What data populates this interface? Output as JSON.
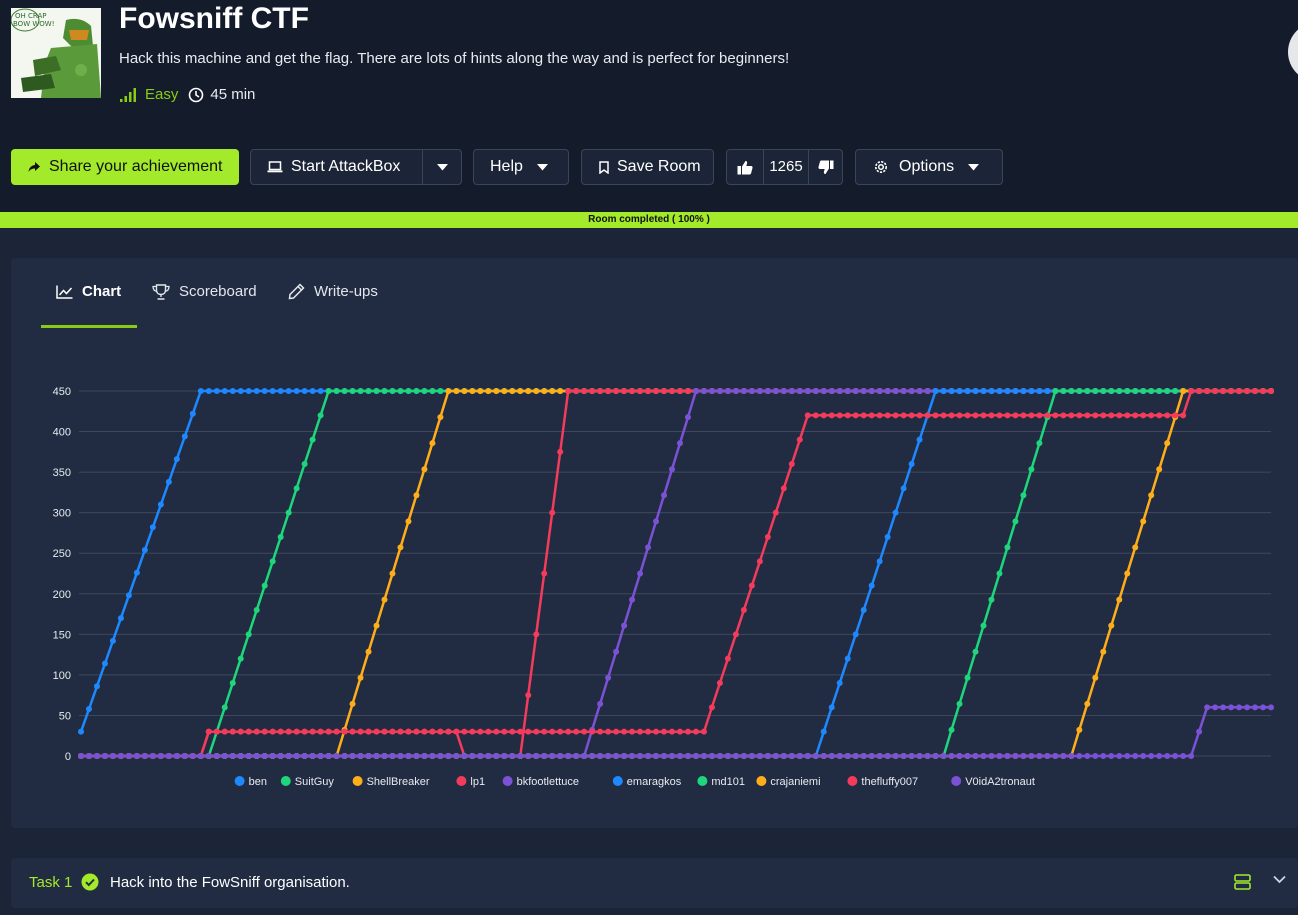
{
  "room": {
    "title": "Fowsniff CTF",
    "description": "Hack this machine and get the flag. There are lots of hints along the way and is perfect for beginners!",
    "difficulty": "Easy",
    "duration": "45 min",
    "avatar_text": [
      "OH CRAP",
      "BOW WOW!"
    ]
  },
  "actions": {
    "share_label": "Share your achievement",
    "attackbox_label": "Start AttackBox",
    "help_label": "Help",
    "save_label": "Save Room",
    "votes": "1265",
    "options_label": "Options"
  },
  "progress": {
    "label": "Room completed ( 100% )",
    "value": 100
  },
  "tabs": {
    "chart": "Chart",
    "scoreboard": "Scoreboard",
    "writeups": "Write-ups"
  },
  "task": {
    "number": "Task 1",
    "title": "Hack into the FowSniff organisation."
  },
  "colors": {
    "accent": "#a3ea2a",
    "bg": "#1c2538",
    "panel": "#212c42"
  },
  "chart_data": {
    "type": "line",
    "x_points": 150,
    "ylim": [
      0,
      450
    ],
    "yticks": [
      0,
      50,
      100,
      150,
      200,
      250,
      300,
      350,
      400,
      450
    ],
    "legend_position": "bottom",
    "grid": true,
    "series": [
      {
        "name": "ben",
        "color": "#1e88ff",
        "segments": [
          [
            0,
            30
          ],
          [
            15,
            450
          ],
          [
            149,
            450
          ]
        ]
      },
      {
        "name": "SuitGuy",
        "color": "#1ed67c",
        "segments": [
          [
            0,
            0
          ],
          [
            16,
            0
          ],
          [
            31,
            450
          ],
          [
            149,
            450
          ]
        ]
      },
      {
        "name": "ShellBreaker",
        "color": "#ffae1a",
        "segments": [
          [
            0,
            0
          ],
          [
            32,
            0
          ],
          [
            46,
            450
          ],
          [
            149,
            450
          ]
        ]
      },
      {
        "name": "lp1",
        "color": "#f43b5c",
        "segments": [
          [
            0,
            0
          ],
          [
            15,
            0
          ],
          [
            16,
            30
          ],
          [
            47,
            30
          ],
          [
            48,
            0
          ],
          [
            55,
            0
          ],
          [
            61,
            450
          ],
          [
            149,
            450
          ]
        ]
      },
      {
        "name": "bkfootlettuce",
        "color": "#7b52d6",
        "segments": [
          [
            0,
            0
          ],
          [
            47,
            0
          ],
          [
            63,
            0
          ],
          [
            77,
            450
          ],
          [
            149,
            450
          ]
        ]
      },
      {
        "name": "emaragkos",
        "color": "#1e88ff",
        "segments": [
          [
            0,
            0
          ],
          [
            92,
            0
          ],
          [
            107,
            450
          ],
          [
            149,
            450
          ]
        ]
      },
      {
        "name": "md101",
        "color": "#1ed67c",
        "segments": [
          [
            0,
            0
          ],
          [
            108,
            0
          ],
          [
            122,
            450
          ],
          [
            149,
            450
          ]
        ]
      },
      {
        "name": "crajaniemi",
        "color": "#ffae1a",
        "segments": [
          [
            0,
            0
          ],
          [
            124,
            0
          ],
          [
            138,
            450
          ],
          [
            149,
            450
          ]
        ]
      },
      {
        "name": "thefluffy007",
        "color": "#f43b5c",
        "segments": [
          [
            0,
            0
          ],
          [
            15,
            0
          ],
          [
            16,
            30
          ],
          [
            78,
            30
          ],
          [
            91,
            420
          ],
          [
            138,
            420
          ],
          [
            139,
            450
          ],
          [
            149,
            450
          ]
        ]
      },
      {
        "name": "V0idA2tronaut",
        "color": "#7b52d6",
        "segments": [
          [
            0,
            0
          ],
          [
            139,
            0
          ],
          [
            141,
            60
          ],
          [
            149,
            60
          ]
        ]
      }
    ]
  }
}
